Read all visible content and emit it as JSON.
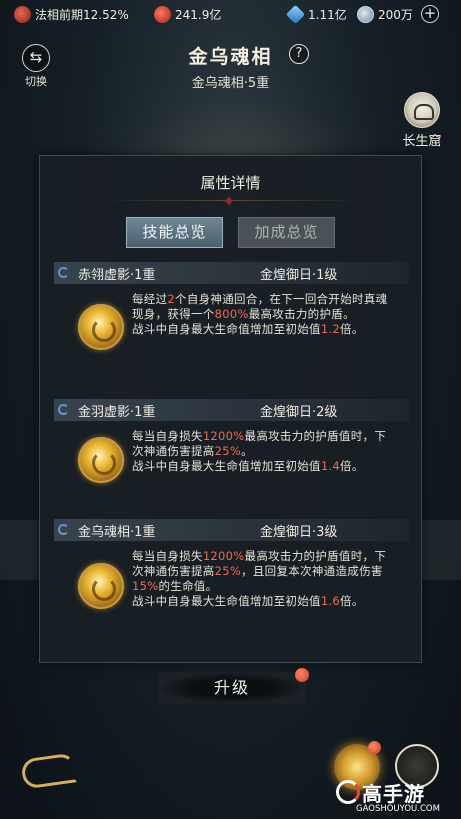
{
  "topbar": {
    "realm": {
      "icon": "realm-icon",
      "text": "法相前期12.52%"
    },
    "power": {
      "icon": "power-icon",
      "text": "241.9亿"
    },
    "gems": {
      "icon": "gem-icon",
      "text": "1.11亿"
    },
    "coins": {
      "icon": "coin-icon",
      "text": "200万"
    },
    "plus_label": "+"
  },
  "header": {
    "switch_icon": "⇆",
    "switch_label": "切换",
    "title": "金乌魂相",
    "help_label": "?",
    "subtitle": "金乌魂相·5重",
    "nest_label": "长生窟"
  },
  "panel": {
    "title": "属性详情",
    "tabs": [
      {
        "label": "技能总览",
        "active": true
      },
      {
        "label": "加成总览",
        "active": false
      }
    ],
    "skills": [
      {
        "name": "赤翎虚影·1重",
        "source": "金煌御日·1级",
        "desc": [
          {
            "t": "每经过"
          },
          {
            "t": "2",
            "hl": true
          },
          {
            "t": "个自身神通回合，在下一回合开始时真魂现身，获得一个"
          },
          {
            "t": "800%",
            "hl": true
          },
          {
            "t": "最高攻击力的护盾。"
          },
          {
            "br": true
          },
          {
            "t": "战斗中自身最大生命值增加至初始值"
          },
          {
            "t": "1.2",
            "hl": true
          },
          {
            "t": "倍。"
          }
        ]
      },
      {
        "name": "金羽虚影·1重",
        "source": "金煌御日·2级",
        "desc": [
          {
            "t": "每当自身损失"
          },
          {
            "t": "1200%",
            "hl": true
          },
          {
            "t": "最高攻击力的护盾值时，下次神通伤害提高"
          },
          {
            "t": "25%",
            "hl": true
          },
          {
            "t": "。"
          },
          {
            "br": true
          },
          {
            "t": "战斗中自身最大生命值增加至初始值"
          },
          {
            "t": "1.4",
            "hl": true
          },
          {
            "t": "倍。"
          }
        ]
      },
      {
        "name": "金乌魂相·1重",
        "source": "金煌御日·3级",
        "desc": [
          {
            "t": "每当自身损失"
          },
          {
            "t": "1200%",
            "hl": true
          },
          {
            "t": "最高攻击力的护盾值时，下次神通伤害提高"
          },
          {
            "t": "25%",
            "hl": true
          },
          {
            "t": "，且回复本次神通造成伤害"
          },
          {
            "t": "15%",
            "hl": true
          },
          {
            "t": "的生命值。"
          },
          {
            "br": true
          },
          {
            "t": "战斗中自身最大生命值增加至初始值"
          },
          {
            "t": "1.6",
            "hl": true
          },
          {
            "t": "倍。"
          }
        ]
      }
    ]
  },
  "upgrade_label": "升级",
  "watermark": {
    "main": "高手游",
    "sub": "GAOSHOUYOU.COM"
  },
  "colors": {
    "highlight": "#f06a50",
    "accent_gold": "#d7b15a",
    "tab_active": "#5f7887"
  }
}
